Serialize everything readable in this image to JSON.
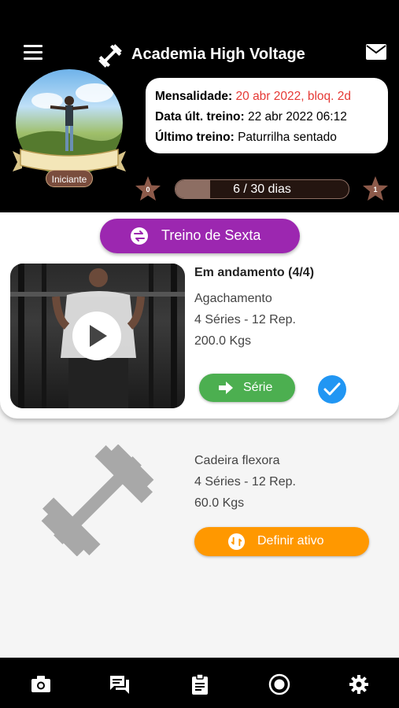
{
  "header": {
    "title": "Academia High Voltage",
    "icons": [
      "menu-icon",
      "dumbbell-icon",
      "mail-icon"
    ]
  },
  "profile": {
    "level": "Iniciante",
    "info": {
      "fee_label": "Mensalidade:",
      "fee_value": "20 abr 2022, bloq. 2d",
      "last_date_label": "Data últ. treino:",
      "last_date_value": "22 abr 2022 06:12",
      "last_workout_label": "Último treino:",
      "last_workout_value": "Paturrilha sentado"
    },
    "progress": {
      "left_star": "0",
      "right_star": "1",
      "text": "6 / 30 dias",
      "fraction": 0.2
    }
  },
  "workout": {
    "button_label": "Treino de Sexta"
  },
  "exercises": [
    {
      "status": "Em andamento (4/4)",
      "name": "Agachamento",
      "sets": "4 Séries - 12 Rep.",
      "weight": "200.0 Kgs",
      "action_label": "Série"
    },
    {
      "name": "Cadeira flexora",
      "sets": "4 Séries - 12 Rep.",
      "weight": "60.0 Kgs",
      "action_label": "Definir ativo"
    }
  ],
  "bottom_nav": [
    "camera-icon",
    "chat-icon",
    "clipboard-icon",
    "record-icon",
    "settings-icon"
  ],
  "colors": {
    "header_bg": "#000000",
    "alert": "#e53935",
    "workout_button": "#9c27b0",
    "serie_button": "#4caf50",
    "check": "#2196f3",
    "activate_button": "#ff9800",
    "progress": "#8d6e63"
  }
}
